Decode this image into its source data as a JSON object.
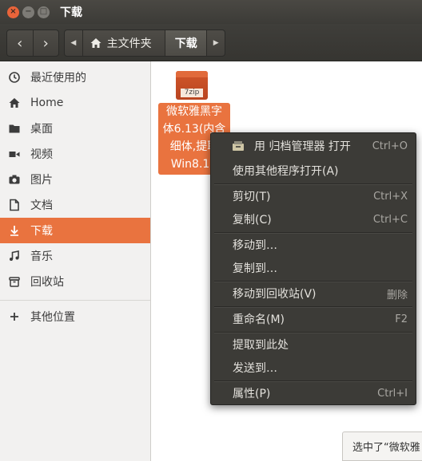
{
  "window": {
    "title": "下载",
    "buttons": {
      "close": "×",
      "minimize": "−",
      "maximize": "□"
    }
  },
  "toolbar": {
    "back_icon": "‹",
    "forward_icon": "›",
    "path_left_arrow": "◀",
    "path_right_arrow": "▶",
    "breadcrumb_home": "主文件夹",
    "breadcrumb_current": "下载"
  },
  "sidebar": {
    "items": [
      {
        "label": "最近使用的",
        "icon": "clock-icon"
      },
      {
        "label": "Home",
        "icon": "home-icon"
      },
      {
        "label": "桌面",
        "icon": "folder-icon"
      },
      {
        "label": "视频",
        "icon": "video-icon"
      },
      {
        "label": "图片",
        "icon": "camera-icon"
      },
      {
        "label": "文档",
        "icon": "document-icon"
      },
      {
        "label": "下载",
        "icon": "download-icon",
        "active": true
      },
      {
        "label": "音乐",
        "icon": "music-icon"
      },
      {
        "label": "回收站",
        "icon": "trash-icon"
      }
    ],
    "other_locations": {
      "label": "其他位置",
      "icon": "plus-icon"
    }
  },
  "file": {
    "icon_label": "7zip",
    "name_lines": [
      "微软雅黑字",
      "体6.13(内含",
      "细体,提取",
      "Win8.1)."
    ]
  },
  "context_menu": {
    "items": [
      {
        "label": "用 归档管理器 打开",
        "accel": "Ctrl+O",
        "icon": "archive-manager-icon"
      },
      {
        "label": "使用其他程序打开(A)",
        "accel": ""
      },
      {
        "label": "剪切(T)",
        "accel": "Ctrl+X"
      },
      {
        "label": "复制(C)",
        "accel": "Ctrl+C"
      },
      {
        "label": "移动到…",
        "accel": ""
      },
      {
        "label": "复制到…",
        "accel": ""
      },
      {
        "label": "移动到回收站(V)",
        "accel": "删除"
      },
      {
        "label": "重命名(M)",
        "accel": "F2"
      },
      {
        "label": "提取到此处",
        "accel": ""
      },
      {
        "label": "发送到…",
        "accel": ""
      },
      {
        "label": "属性(P)",
        "accel": "Ctrl+I"
      }
    ]
  },
  "status": {
    "text": "选中了“微软雅"
  },
  "colors": {
    "accent": "#e9733f",
    "titlebar": "#3c3b37",
    "menu_bg": "#3c3b37",
    "sidebar_bg": "#f2f1f0"
  }
}
